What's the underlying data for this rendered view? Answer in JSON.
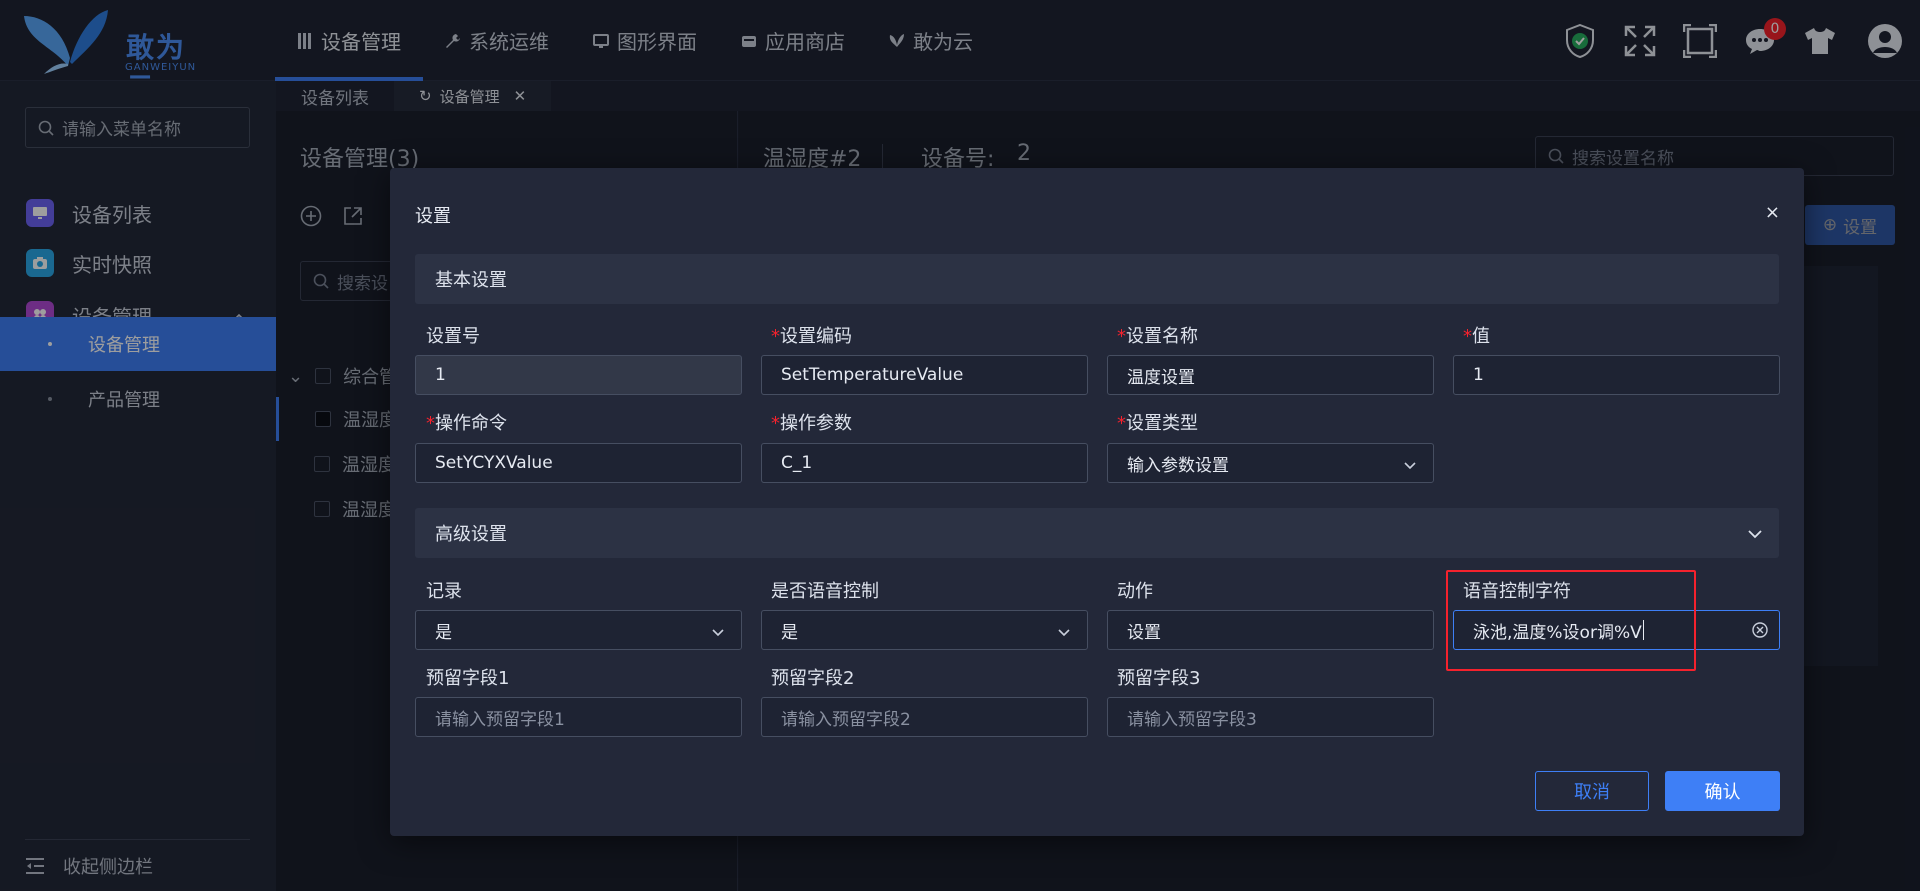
{
  "app": {
    "logo_text": "敢为云",
    "logo_sub": "GANWEIYUN"
  },
  "nav": [
    {
      "label": "设备管理",
      "active": true
    },
    {
      "label": "系统运维"
    },
    {
      "label": "图形界面"
    },
    {
      "label": "应用商店"
    },
    {
      "label": "敢为云"
    }
  ],
  "top_icons": {
    "notifications_count": "0"
  },
  "tabs": [
    {
      "label": "设备列表"
    },
    {
      "label": "设备管理",
      "active": true
    }
  ],
  "sidebar": {
    "search_placeholder": "请输入菜单名称",
    "items": [
      {
        "label": "设备列表"
      },
      {
        "label": "实时快照"
      },
      {
        "label": "设备管理"
      }
    ],
    "sub_items": [
      {
        "label": "设备管理",
        "active": true
      },
      {
        "label": "产品管理"
      }
    ],
    "footer_label": "收起侧边栏"
  },
  "background": {
    "left_title": "设备管理(3)",
    "left_search": "搜索设",
    "tree_group": "综合管",
    "tree_items": [
      "温湿度",
      "温湿度",
      "温湿度"
    ],
    "device_name": "温湿度#2",
    "device_no_label": "设备号:",
    "device_no": "2",
    "setting_search_placeholder": "搜索设置名称",
    "add_setting_label": "设置"
  },
  "modal": {
    "title": "设置",
    "close": "×",
    "basic_section": "基本设置",
    "advanced_section": "高级设置",
    "fields": {
      "setting_no": {
        "label": "设置号",
        "value": "1"
      },
      "setting_code": {
        "label": "设置编码",
        "value": "SetTemperatureValue"
      },
      "setting_name": {
        "label": "设置名称",
        "value": "温度设置"
      },
      "value": {
        "label": "值",
        "value": "1"
      },
      "command": {
        "label": "操作命令",
        "value": "SetYCYXValue"
      },
      "param": {
        "label": "操作参数",
        "value": "C_1"
      },
      "setting_type": {
        "label": "设置类型",
        "value": "输入参数设置"
      },
      "record": {
        "label": "记录",
        "value": "是"
      },
      "voice_control": {
        "label": "是否语音控制",
        "value": "是"
      },
      "action": {
        "label": "动作",
        "value": "设置"
      },
      "voice_string": {
        "label": "语音控制字符",
        "value": "泳池,温度%设or调%V"
      },
      "reserved1": {
        "label": "预留字段1",
        "placeholder": "请输入预留字段1"
      },
      "reserved2": {
        "label": "预留字段2",
        "placeholder": "请输入预留字段2"
      },
      "reserved3": {
        "label": "预留字段3",
        "placeholder": "请输入预留字段3"
      }
    },
    "cancel": "取消",
    "confirm": "确认"
  },
  "colors": {
    "accent": "#3e7ff6",
    "required": "#f5222d",
    "highlight": "#f5222d"
  }
}
